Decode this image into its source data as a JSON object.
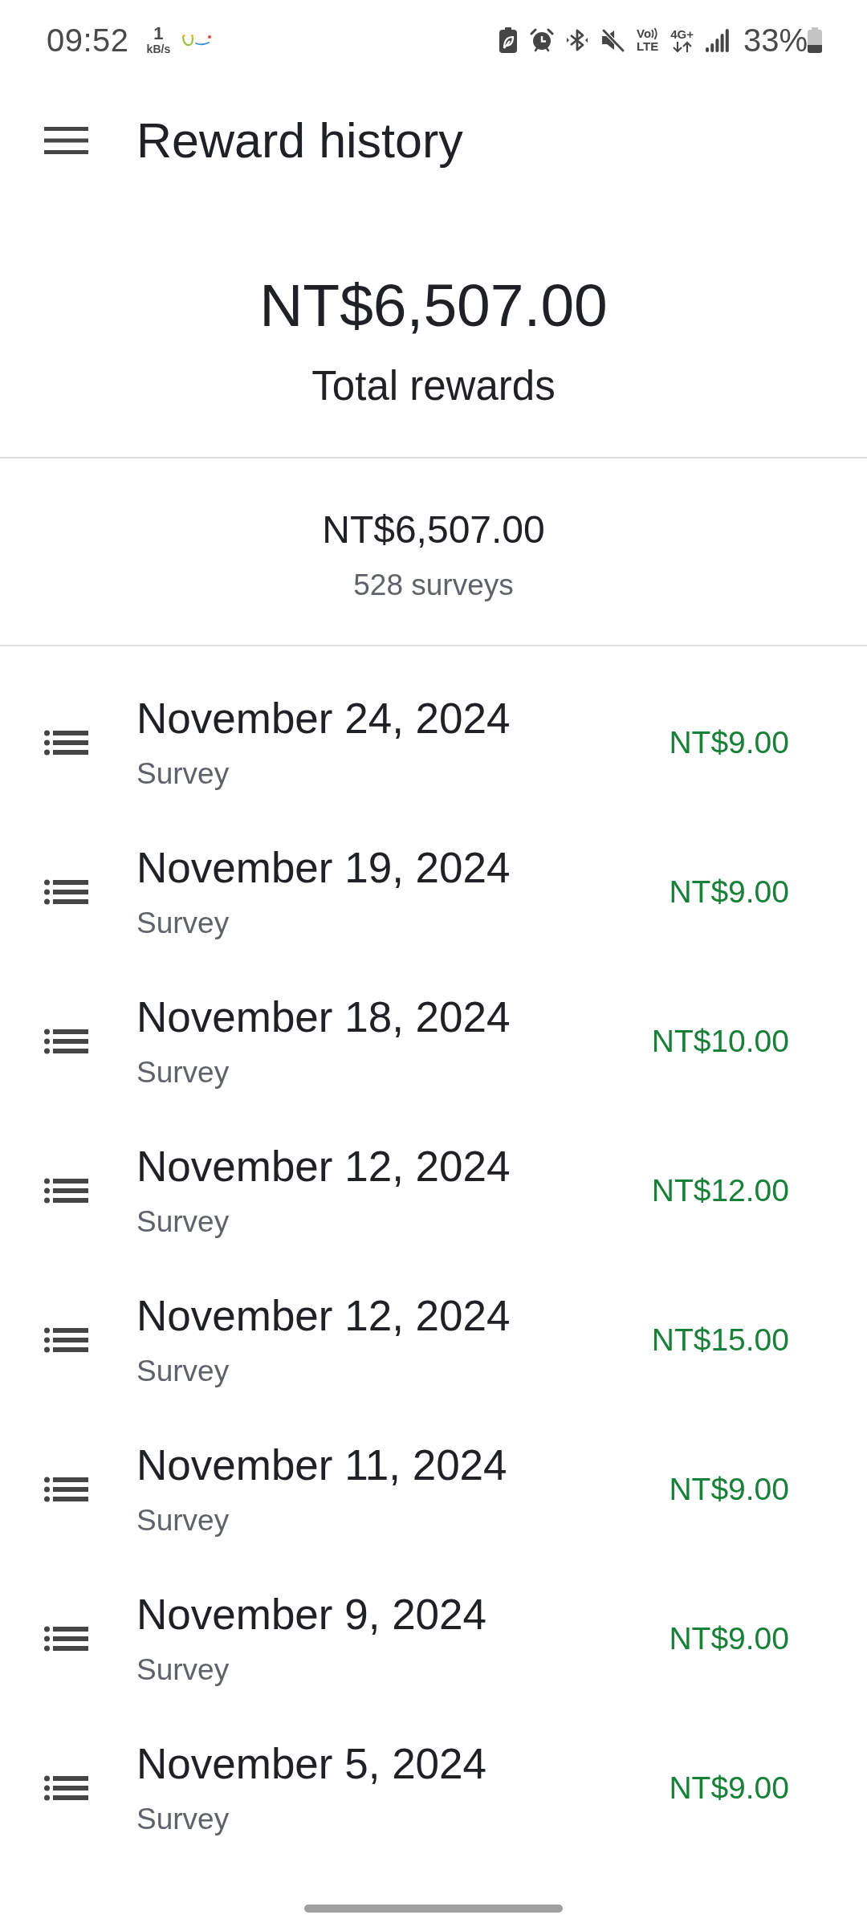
{
  "status_bar": {
    "time": "09:52",
    "data_speed": {
      "value": "1",
      "unit": "kB/s"
    },
    "volte": {
      "top": "Vo",
      "bottom": "LTE"
    },
    "network": "4G+",
    "battery": "33%"
  },
  "app_bar": {
    "title": "Reward history"
  },
  "total": {
    "amount": "NT$6,507.00",
    "label": "Total rewards"
  },
  "summary": {
    "amount": "NT$6,507.00",
    "count": "528 surveys"
  },
  "rewards": [
    {
      "date": "November 24, 2024",
      "type": "Survey",
      "amount": "NT$9.00"
    },
    {
      "date": "November 19, 2024",
      "type": "Survey",
      "amount": "NT$9.00"
    },
    {
      "date": "November 18, 2024",
      "type": "Survey",
      "amount": "NT$10.00"
    },
    {
      "date": "November 12, 2024",
      "type": "Survey",
      "amount": "NT$12.00"
    },
    {
      "date": "November 12, 2024",
      "type": "Survey",
      "amount": "NT$15.00"
    },
    {
      "date": "November 11, 2024",
      "type": "Survey",
      "amount": "NT$9.00"
    },
    {
      "date": "November 9, 2024",
      "type": "Survey",
      "amount": "NT$9.00"
    },
    {
      "date": "November 5, 2024",
      "type": "Survey",
      "amount": "NT$9.00"
    }
  ]
}
